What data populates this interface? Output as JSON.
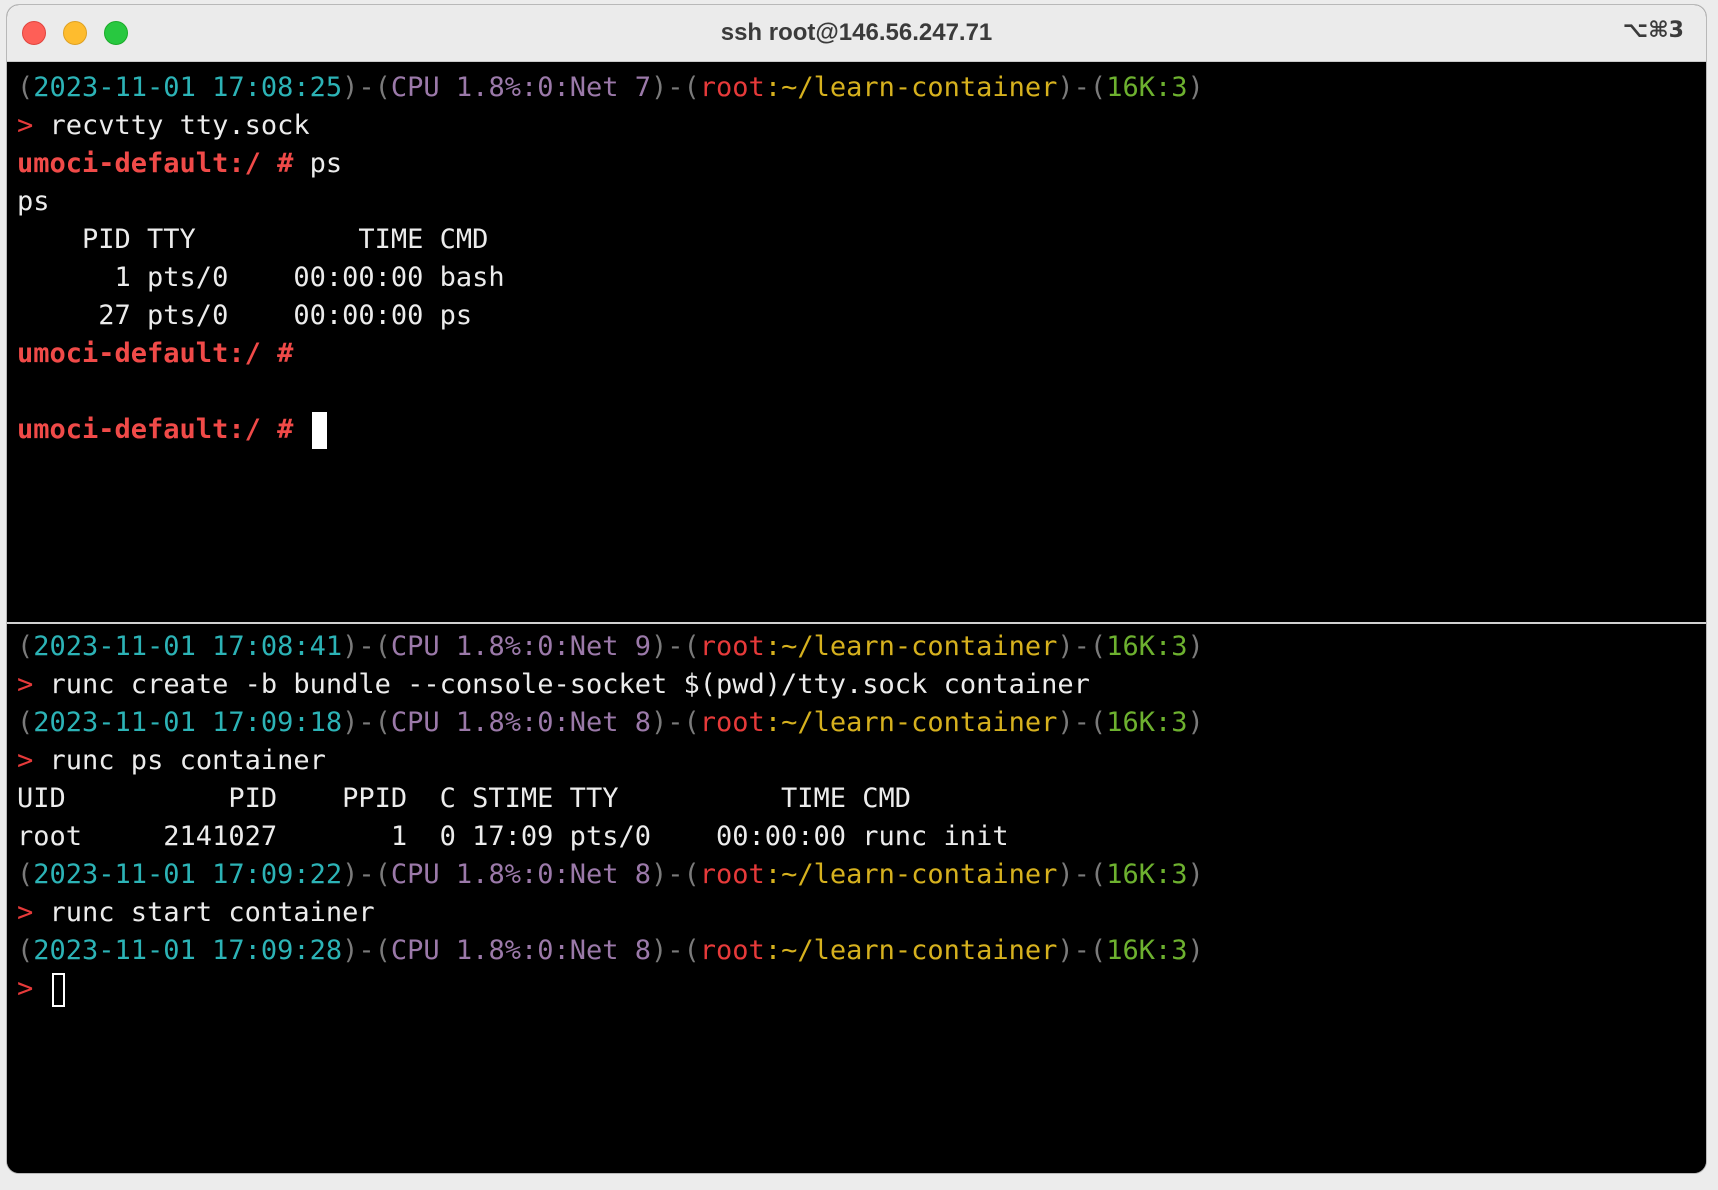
{
  "window": {
    "title": "ssh root@146.56.247.71",
    "shortcut": "⌥⌘3"
  },
  "top_pane": {
    "status": {
      "timestamp": "2023-11-01 17:08:25",
      "cpu": "CPU 1.8%:0:Net 7",
      "user": "root",
      "path": "~/learn-container",
      "history": "16K:3"
    },
    "command": "recvtty tty.sock",
    "prompt": "umoci-default:/ #",
    "ps_command": "ps",
    "ps_echo": "ps",
    "ps_header": "    PID TTY          TIME CMD",
    "ps_rows": [
      "      1 pts/0    00:00:00 bash",
      "     27 pts/0    00:00:00 ps"
    ]
  },
  "bottom_pane": {
    "status_lines": [
      {
        "timestamp": "2023-11-01 17:08:41",
        "cpu": "CPU 1.8%:0:Net 9",
        "user": "root",
        "path": "~/learn-container",
        "history": "16K:3"
      },
      {
        "timestamp": "2023-11-01 17:09:18",
        "cpu": "CPU 1.8%:0:Net 8",
        "user": "root",
        "path": "~/learn-container",
        "history": "16K:3"
      },
      {
        "timestamp": "2023-11-01 17:09:22",
        "cpu": "CPU 1.8%:0:Net 8",
        "user": "root",
        "path": "~/learn-container",
        "history": "16K:3"
      },
      {
        "timestamp": "2023-11-01 17:09:28",
        "cpu": "CPU 1.8%:0:Net 8",
        "user": "root",
        "path": "~/learn-container",
        "history": "16K:3"
      }
    ],
    "commands": [
      "runc create -b bundle --console-socket $(pwd)/tty.sock container",
      "runc ps container",
      "runc start container"
    ],
    "runc_ps_header": "UID          PID    PPID  C STIME TTY          TIME CMD",
    "runc_ps_row": "root     2141027       1  0 17:09 pts/0    00:00:00 runc init"
  },
  "symbols": {
    "arrow": ">",
    "open_paren": "(",
    "close_paren": ")",
    "sep": ")-(",
    "colon": ":"
  }
}
